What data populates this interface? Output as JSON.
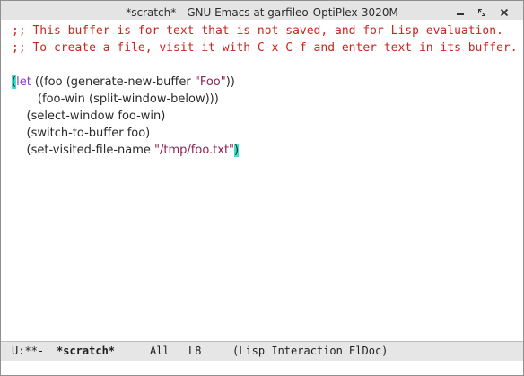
{
  "window": {
    "title": "*scratch* - GNU Emacs at garfileo-OptiPlex-3020M"
  },
  "buffer": {
    "comments": [
      ";; This buffer is for text that is not saved, and for Lisp evaluation.",
      ";; To create a file, visit it with C-x C-f and enter text in its buffer."
    ],
    "code": {
      "l1_open": "(",
      "l1_kw": "let",
      "l1_a": " ((foo (generate-new-buffer ",
      "l1_str": "\"Foo\"",
      "l1_b": "))",
      "l2": "       (foo-win (split-window-below)))",
      "l3": "    (select-window foo-win)",
      "l4": "    (switch-to-buffer foo)",
      "l5_a": "    (set-visited-file-name ",
      "l5_str": "\"/tmp/foo.txt\"",
      "l5_close": ")"
    }
  },
  "modeline": {
    "status": "U:**-",
    "buffer_name": "*scratch*",
    "position": "All",
    "line": "L8",
    "modes": "(Lisp Interaction ElDoc)"
  },
  "colors": {
    "comment": "#c8261f",
    "keyword": "#8a3fbf",
    "string": "#8b2252",
    "paren_highlight": "#40e0d0"
  }
}
